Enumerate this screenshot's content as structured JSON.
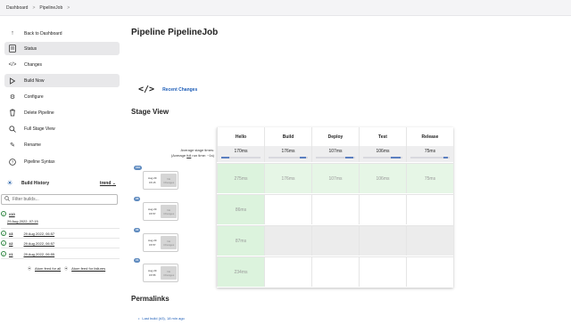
{
  "breadcrumb": {
    "items": [
      "Dashboard",
      "PipelineJob"
    ],
    "separator": ">"
  },
  "sidebar": {
    "items": [
      {
        "label": "Back to Dashboard",
        "icon": "arrow-up-icon"
      },
      {
        "label": "Status",
        "icon": "document-icon"
      },
      {
        "label": "Changes",
        "icon": "code-icon"
      },
      {
        "label": "Build Now",
        "icon": "play-icon"
      },
      {
        "label": "Configure",
        "icon": "gear-icon"
      },
      {
        "label": "Delete Pipeline",
        "icon": "trash-icon"
      },
      {
        "label": "Full Stage View",
        "icon": "search-icon"
      },
      {
        "label": "Rename",
        "icon": "pencil-icon"
      },
      {
        "label": "Pipeline Syntax",
        "icon": "help-icon"
      }
    ]
  },
  "build_history": {
    "title": "Build History",
    "trend_label": "trend",
    "filter_placeholder": "Filter builds...",
    "builds": [
      {
        "number": "#10",
        "date": "29 Aug 2022, 07:15"
      },
      {
        "number": "#3",
        "date": "29 Aug 2022, 06:57"
      },
      {
        "number": "#2",
        "date": "29 Aug 2022, 06:57"
      },
      {
        "number": "#1",
        "date": "29 Aug 2022, 06:55"
      }
    ],
    "feed_all": "Atom feed for all",
    "feed_failures": "Atom feed for failures"
  },
  "main": {
    "title": "Pipeline PipelineJob",
    "recent_changes": "Recent Changes",
    "stage_view_title": "Stage View",
    "avg_stage_times": "Average stage times:",
    "avg_full_run_prefix": "(Average ",
    "avg_full_run_link": "full",
    "avg_full_run_suffix": " run time: ~1s)",
    "stages": [
      {
        "name": "Hello",
        "avg": "170ms",
        "bar_fraction": 0.2
      },
      {
        "name": "Build",
        "avg": "176ms",
        "bar_fraction": 0.15
      },
      {
        "name": "Deploy",
        "avg": "107ms",
        "bar_fraction": 0.2
      },
      {
        "name": "Test",
        "avg": "106ms",
        "bar_fraction": 0.25
      },
      {
        "name": "Release",
        "avg": "75ms",
        "bar_fraction": 0.12
      }
    ],
    "runs": [
      {
        "badge": "#10",
        "date": "Aug 29",
        "time": "15:15",
        "no_changes_1": "No",
        "no_changes_2": "Changes",
        "cells": [
          "275ms",
          "176ms",
          "107ms",
          "106ms",
          "75ms"
        ]
      },
      {
        "badge": "#3",
        "date": "Aug 29",
        "time": "15:57",
        "no_changes_1": "No",
        "no_changes_2": "Changes",
        "cells": [
          "86ms",
          "",
          "",
          "",
          ""
        ]
      },
      {
        "badge": "#2",
        "date": "Aug 29",
        "time": "15:57",
        "no_changes_1": "No",
        "no_changes_2": "Changes",
        "cells": [
          "87ms",
          "",
          "",
          "",
          ""
        ]
      },
      {
        "badge": "#1",
        "date": "Aug 29",
        "time": "15:55",
        "no_changes_1": "No",
        "no_changes_2": "Changes",
        "cells": [
          "234ms",
          "",
          "",
          "",
          ""
        ]
      }
    ],
    "permalinks_title": "Permalinks",
    "permalinks": [
      "Last build (#3), 18 min ago"
    ]
  }
}
